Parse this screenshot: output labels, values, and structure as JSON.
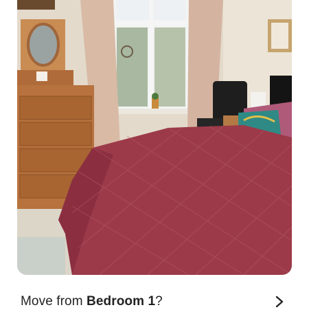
{
  "photo": {
    "icon": "bedroom-photo",
    "colors": {
      "bedspread": "#9c3a4a",
      "wall": "#e6ddd0",
      "dresser": "#b06b3a",
      "curtain": "#d6b8a4"
    }
  },
  "caption": {
    "prefix": "Move from ",
    "room": "Bedroom 1",
    "suffix": "?",
    "icon": "chevron-right-icon"
  }
}
